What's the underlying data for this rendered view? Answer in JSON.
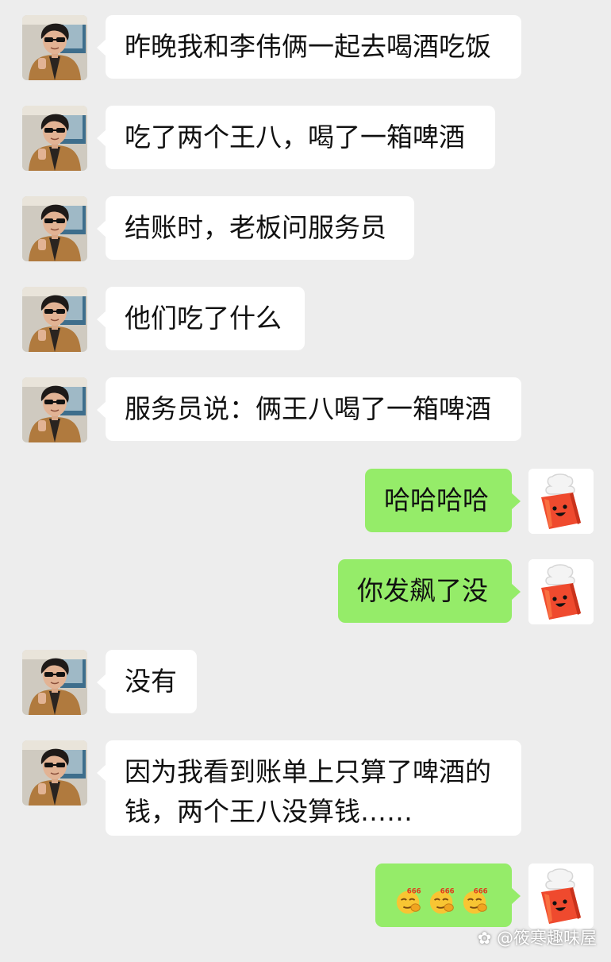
{
  "messages": [
    {
      "side": "left",
      "text": "昨晚我和李伟俩一起去喝酒吃饭"
    },
    {
      "side": "left",
      "text": "吃了两个王八，喝了一箱啤酒"
    },
    {
      "side": "left",
      "text": "结账时，老板问服务员"
    },
    {
      "side": "left",
      "text": "他们吃了什么"
    },
    {
      "side": "left",
      "text": "服务员说：俩王八喝了一箱啤酒"
    },
    {
      "side": "right",
      "text": "哈哈哈哈"
    },
    {
      "side": "right",
      "text": "你发飙了没"
    },
    {
      "side": "left",
      "text": "没有"
    },
    {
      "side": "left",
      "text_line1": "因为我看到账单上只算了啤酒的",
      "text_line2": "钱，两个王八没算钱……"
    },
    {
      "side": "right",
      "emojis": [
        "666",
        "666",
        "666"
      ]
    }
  ],
  "watermark": "@筱寒趣味屋",
  "colors": {
    "background": "#ededed",
    "incoming_bubble": "#ffffff",
    "outgoing_bubble": "#95ec69"
  },
  "icons": {
    "incoming_avatar": "sunglasses-man-avatar",
    "outgoing_avatar": "red-bag-mascot-avatar",
    "emoji": "smirk-666-emoji"
  }
}
